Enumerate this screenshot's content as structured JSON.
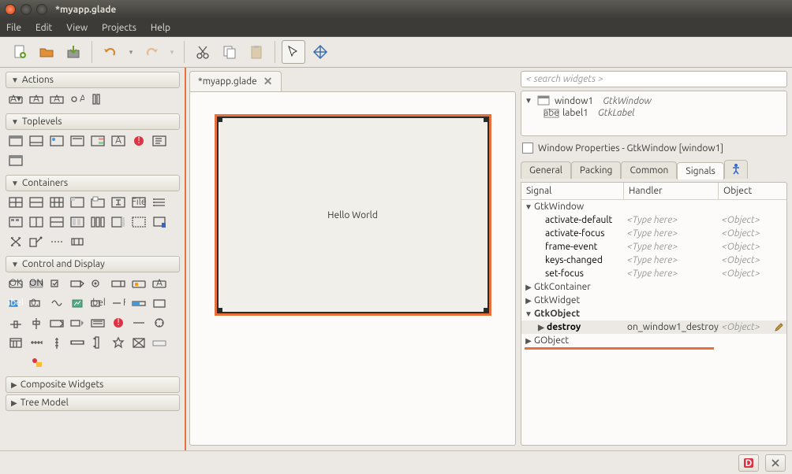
{
  "window": {
    "title": "*myapp.glade"
  },
  "menu": {
    "items": [
      "File",
      "Edit",
      "View",
      "Projects",
      "Help"
    ]
  },
  "palette": {
    "actions": {
      "label": "Actions"
    },
    "toplevels": {
      "label": "Toplevels"
    },
    "containers": {
      "label": "Containers"
    },
    "control": {
      "label": "Control and Display"
    },
    "composite": {
      "label": "Composite Widgets"
    },
    "treemodel": {
      "label": "Tree Model"
    }
  },
  "document": {
    "tab": "*myapp.glade",
    "label_text": "Hello World"
  },
  "inspector": {
    "search_placeholder": "< search widgets >",
    "tree": [
      {
        "name": "window1",
        "class": "GtkWindow",
        "icon": "window"
      },
      {
        "name": "label1",
        "class": "GtkLabel",
        "icon": "label",
        "indent": 1
      }
    ],
    "props_title": "Window Properties - GtkWindow [window1]",
    "tabs": {
      "general": "General",
      "packing": "Packing",
      "common": "Common",
      "signals": "Signals"
    },
    "columns": {
      "signal": "Signal",
      "handler": "Handler",
      "object": "Object"
    },
    "placeholders": {
      "handler": "<Type here>",
      "object": "<Object>"
    },
    "signals": {
      "GtkWindow": [
        "activate-default",
        "activate-focus",
        "frame-event",
        "keys-changed",
        "set-focus"
      ],
      "GtkContainer": [],
      "GtkWidget": [],
      "GtkObject": [
        {
          "name": "destroy",
          "handler": "on_window1_destroy",
          "object": "<Object>",
          "selected": true
        }
      ],
      "GObject": []
    }
  }
}
